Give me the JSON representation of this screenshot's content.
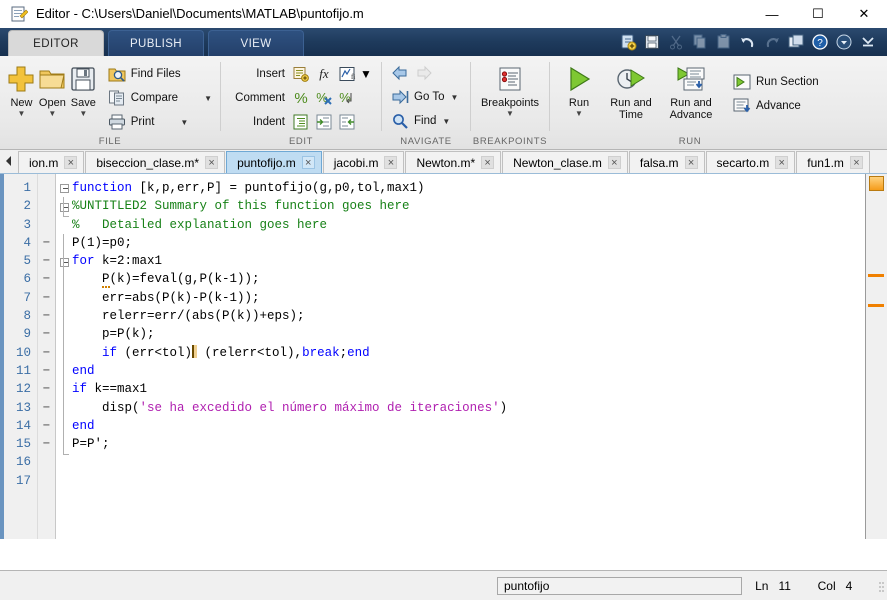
{
  "window": {
    "title": "Editor - C:\\Users\\Daniel\\Documents\\MATLAB\\puntofijo.m",
    "icon": "editor-document-icon",
    "minimize": "—",
    "maximize": "☐",
    "close": "✕"
  },
  "ribbon_tabs": [
    {
      "label": "EDITOR",
      "active": true
    },
    {
      "label": "PUBLISH",
      "active": false
    },
    {
      "label": "VIEW",
      "active": false
    }
  ],
  "quick_access": [
    {
      "name": "new-script-icon"
    },
    {
      "name": "save-icon"
    },
    {
      "name": "cut-icon"
    },
    {
      "name": "copy-icon"
    },
    {
      "name": "paste-icon"
    },
    {
      "name": "undo-icon"
    },
    {
      "name": "redo-icon"
    },
    {
      "name": "switch-window-icon"
    },
    {
      "name": "help-icon"
    },
    {
      "name": "customize-dropdown-icon"
    },
    {
      "name": "minimize-ribbon-icon"
    }
  ],
  "ribbon": {
    "groups": [
      {
        "label": "FILE",
        "big_buttons": [
          {
            "label": "New",
            "icon": "new-file-icon",
            "has_dropdown": true
          },
          {
            "label": "Open",
            "icon": "open-folder-icon",
            "has_dropdown": true
          },
          {
            "label": "Save",
            "icon": "save-disk-icon",
            "has_dropdown": true
          }
        ],
        "small_buttons": [
          {
            "label": "Find Files",
            "icon": "find-files-icon",
            "has_dropdown": false
          },
          {
            "label": "Compare",
            "icon": "compare-icon",
            "has_dropdown": true
          },
          {
            "label": "Print",
            "icon": "print-icon",
            "has_dropdown": true
          }
        ]
      },
      {
        "label": "EDIT",
        "rows": [
          {
            "label": "Insert",
            "icons": [
              "insert-text-icon",
              "insert-function-icon",
              "insert-figure-icon"
            ],
            "has_dropdown": true
          },
          {
            "label": "Comment",
            "icons": [
              "comment-icon",
              "uncomment-icon",
              "wrap-comment-icon"
            ],
            "has_dropdown": false
          },
          {
            "label": "Indent",
            "icons": [
              "smart-indent-icon",
              "indent-right-icon",
              "indent-left-icon"
            ],
            "has_dropdown": false
          }
        ]
      },
      {
        "label": "NAVIGATE",
        "rows": [
          {
            "label": "",
            "icons": [
              "back-arrow-icon",
              "forward-arrow-icon"
            ],
            "has_dropdown": false
          },
          {
            "label": "Go To",
            "icons": [
              "go-to-icon"
            ],
            "has_dropdown": true
          },
          {
            "label": "Find",
            "icons": [
              "find-magnifier-icon"
            ],
            "has_dropdown": true
          }
        ]
      },
      {
        "label": "BREAKPOINTS",
        "big_buttons": [
          {
            "label": "Breakpoints",
            "icon": "breakpoints-icon",
            "has_dropdown": true
          }
        ]
      },
      {
        "label": "RUN",
        "big_buttons": [
          {
            "label": "Run",
            "icon": "run-icon",
            "has_dropdown": true
          },
          {
            "label": "Run and\nTime",
            "icon": "run-and-time-icon",
            "has_dropdown": false
          },
          {
            "label": "Run and\nAdvance",
            "icon": "run-and-advance-icon",
            "has_dropdown": false
          }
        ],
        "small_buttons": [
          {
            "label": "Run Section",
            "icon": "run-section-icon",
            "has_dropdown": false
          },
          {
            "label": "Advance",
            "icon": "advance-icon",
            "has_dropdown": false
          }
        ]
      }
    ]
  },
  "document_tabs": {
    "scroll_left_icon": "tab-scroll-left-icon",
    "tabs": [
      {
        "label": "ion.m",
        "active": false,
        "modified": false
      },
      {
        "label": "biseccion_clase.m*",
        "active": false,
        "modified": true
      },
      {
        "label": "puntofijo.m",
        "active": true,
        "modified": false
      },
      {
        "label": "jacobi.m",
        "active": false,
        "modified": false
      },
      {
        "label": "Newton.m*",
        "active": false,
        "modified": true
      },
      {
        "label": "Newton_clase.m",
        "active": false,
        "modified": false
      },
      {
        "label": "falsa.m",
        "active": false,
        "modified": false
      },
      {
        "label": "secarto.m",
        "active": false,
        "modified": false
      },
      {
        "label": "fun1.m",
        "active": false,
        "modified": false
      }
    ],
    "close_glyph": "×"
  },
  "editor": {
    "line_numbers": [
      "1",
      "2",
      "3",
      "4",
      "5",
      "6",
      "7",
      "8",
      "9",
      "10",
      "11",
      "12",
      "13",
      "14",
      "15",
      "16",
      "17"
    ],
    "executable_marks": [
      "",
      "",
      "",
      "−",
      "−",
      "−",
      "−",
      "−",
      "−",
      "−",
      "−",
      "−",
      "−",
      "−",
      "−",
      "",
      ""
    ],
    "lines": [
      {
        "n": 1,
        "text": "function [k,p,err,P] = puntofijo(g,p0,tol,max1)"
      },
      {
        "n": 2,
        "text": "%UNTITLED2 Summary of this function goes here"
      },
      {
        "n": 3,
        "text": "%   Detailed explanation goes here"
      },
      {
        "n": 4,
        "text": "P(1)=p0;"
      },
      {
        "n": 5,
        "text": "for k=2:max1"
      },
      {
        "n": 6,
        "text": "    P(k)=feval(g,P(k-1));"
      },
      {
        "n": 7,
        "text": "    err=abs(P(k)-P(k-1));"
      },
      {
        "n": 8,
        "text": "    relerr=err/(abs(P(k))+eps);"
      },
      {
        "n": 9,
        "text": "    p=P(k);"
      },
      {
        "n": 10,
        "text": "    if (err<tol)| (relerr<tol),break;end"
      },
      {
        "n": 11,
        "text": "end"
      },
      {
        "n": 12,
        "text": "if k==max1"
      },
      {
        "n": 13,
        "text": "    disp('se ha excedido el número máximo de iteraciones')"
      },
      {
        "n": 14,
        "text": "end"
      },
      {
        "n": 15,
        "text": "P=P';"
      },
      {
        "n": 16,
        "text": ""
      },
      {
        "n": 17,
        "text": ""
      }
    ],
    "cursor": {
      "line": 10,
      "symbol": "text-caret"
    },
    "right_gutter": {
      "status_indicator": "code-analyzer-warning-indicator",
      "warning_marks": 2
    }
  },
  "statusbar": {
    "function_name": "puntofijo",
    "line_label": "Ln",
    "line_value": "11",
    "col_label": "Col",
    "col_value": "4",
    "resize_grip": "resize-grip-icon"
  },
  "colors": {
    "keyword": "#0000ff",
    "comment": "#178117",
    "string": "#b020b0",
    "text": "#000000",
    "active_tab": "#bfdcf2",
    "ribbon_blue": "#1e3a5c",
    "warning_orange": "#f08000"
  }
}
